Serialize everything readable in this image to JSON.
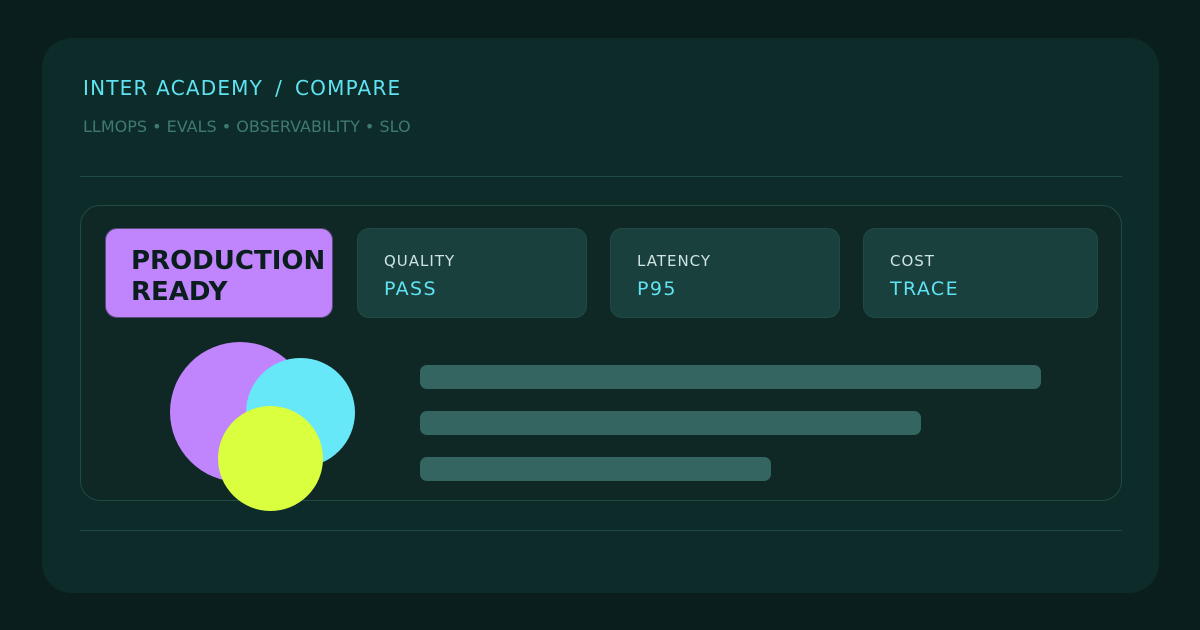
{
  "header": {
    "breadcrumb": [
      "INTER ACADEMY",
      "COMPARE"
    ],
    "separator": "/",
    "tags": "LLMOPS • EVALS • OBSERVABILITY • SLO"
  },
  "badge": {
    "label": "PRODUCTION\nREADY",
    "color": "#c084fc"
  },
  "metrics": [
    {
      "label": "QUALITY",
      "value": "PASS"
    },
    {
      "label": "LATENCY",
      "value": "P95"
    },
    {
      "label": "COST",
      "value": "TRACE"
    }
  ],
  "colors": {
    "background": "#0a1f1d",
    "card": "#0d2b29",
    "accent": "#5fe3f2",
    "purple": "#c084fc",
    "cyan": "#67e8f9",
    "lime": "#d9ff3f",
    "bar": "#346560"
  }
}
